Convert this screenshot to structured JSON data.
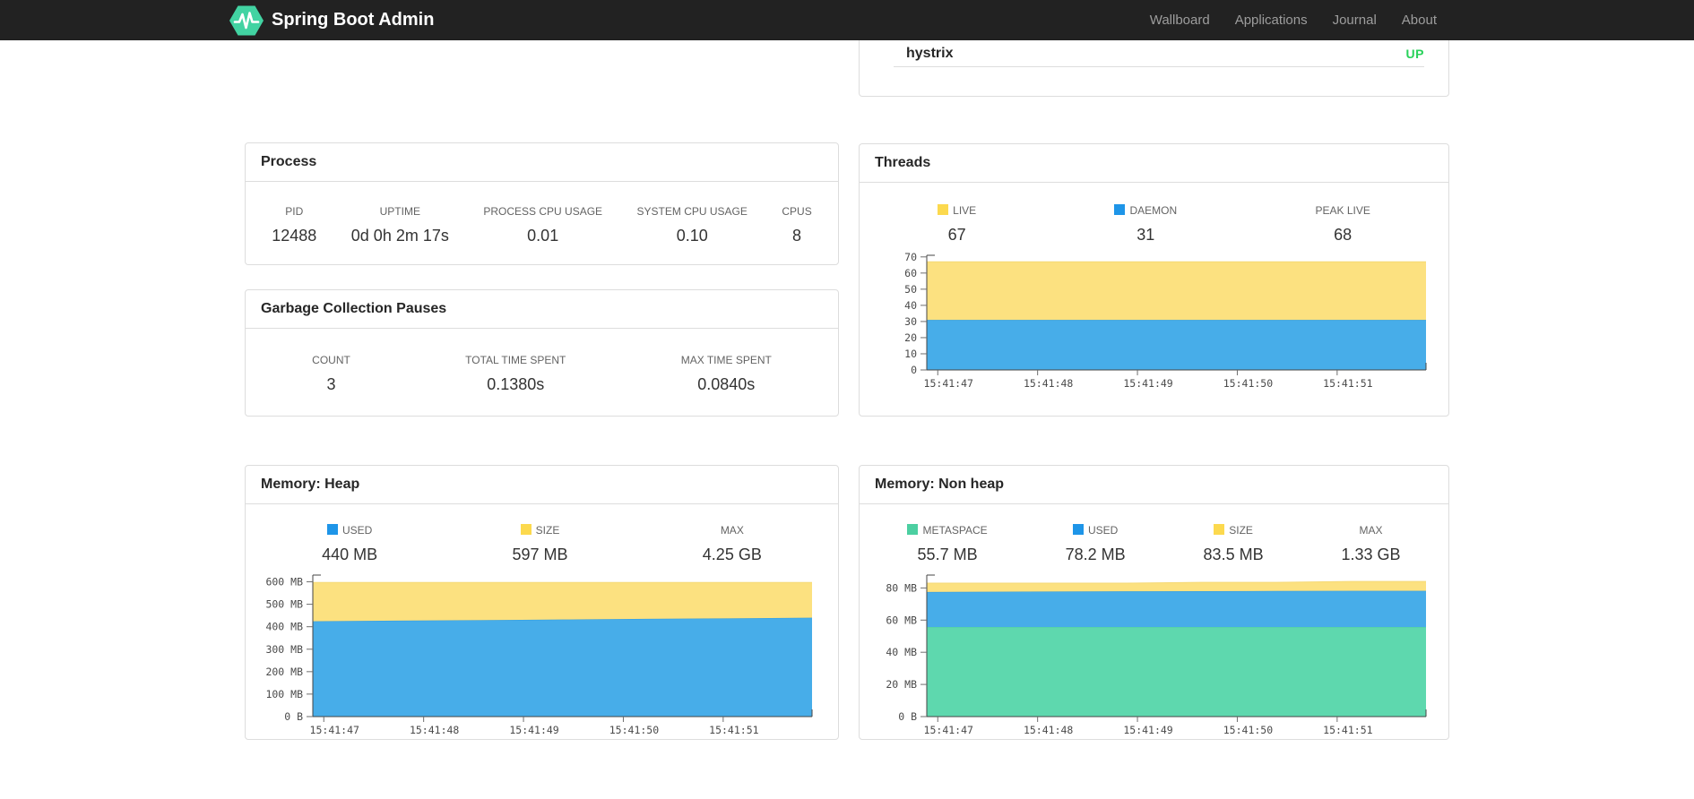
{
  "navbar": {
    "brand": "Spring Boot Admin",
    "items": [
      {
        "label": "Wallboard"
      },
      {
        "label": "Applications"
      },
      {
        "label": "Journal"
      },
      {
        "label": "About"
      }
    ]
  },
  "colors": {
    "navbar_bg": "#222222",
    "nav_link": "#9d9d9d",
    "logo_green": "#42d3a2",
    "status_up": "#28d25a",
    "legend_blue": "#1e95e8",
    "legend_yellow": "#fcd94e",
    "legend_green": "#4ccfa1",
    "area_blue": "#47ade9",
    "area_yellow": "#fce180",
    "area_green": "#5ed8ae",
    "card_border": "#dddddd"
  },
  "health_panel": {
    "row": {
      "name": "hystrix",
      "status": "UP"
    },
    "status_color": "#28d25a"
  },
  "process": {
    "title": "Process",
    "metrics": [
      {
        "label": "PID",
        "value": "12488"
      },
      {
        "label": "UPTIME",
        "value": "0d 0h 2m 17s"
      },
      {
        "label": "PROCESS CPU USAGE",
        "value": "0.01"
      },
      {
        "label": "SYSTEM CPU USAGE",
        "value": "0.10"
      },
      {
        "label": "CPUS",
        "value": "8"
      }
    ]
  },
  "gc": {
    "title": "Garbage Collection Pauses",
    "metrics": [
      {
        "label": "COUNT",
        "value": "3"
      },
      {
        "label": "TOTAL TIME SPENT",
        "value": "0.1380s"
      },
      {
        "label": "MAX TIME SPENT",
        "value": "0.0840s"
      }
    ]
  },
  "threads": {
    "title": "Threads",
    "legend": [
      {
        "label": "LIVE",
        "value": "67",
        "swatch": "#fcd94e"
      },
      {
        "label": "DAEMON",
        "value": "31",
        "swatch": "#1e95e8"
      },
      {
        "label": "PEAK LIVE",
        "value": "68",
        "swatch": ""
      }
    ]
  },
  "memory_heap": {
    "title": "Memory: Heap",
    "legend": [
      {
        "label": "USED",
        "value": "440 MB",
        "swatch": "#1e95e8"
      },
      {
        "label": "SIZE",
        "value": "597 MB",
        "swatch": "#fcd94e"
      },
      {
        "label": "MAX",
        "value": "4.25 GB",
        "swatch": ""
      }
    ]
  },
  "memory_nonheap": {
    "title": "Memory: Non heap",
    "legend": [
      {
        "label": "METASPACE",
        "value": "55.7 MB",
        "swatch": "#4ccfa1"
      },
      {
        "label": "USED",
        "value": "78.2 MB",
        "swatch": "#1e95e8"
      },
      {
        "label": "SIZE",
        "value": "83.5 MB",
        "swatch": "#fcd94e"
      },
      {
        "label": "MAX",
        "value": "1.33 GB",
        "swatch": ""
      }
    ]
  },
  "chart_data": [
    {
      "id": "threads",
      "type": "area",
      "stacked": true,
      "title": "Threads",
      "legend_position": "top",
      "grid": false,
      "x_tick_labels": [
        "15:41:47",
        "15:41:48",
        "15:41:49",
        "15:41:50",
        "15:41:51"
      ],
      "x_tick_fractions": [
        0.022,
        0.222,
        0.422,
        0.622,
        0.822
      ],
      "x_fractions": [
        0,
        0.2,
        0.4,
        0.6,
        0.8,
        1
      ],
      "y_plot_max": 71,
      "y_ticks": [
        {
          "v": 0,
          "label": "0"
        },
        {
          "v": 10,
          "label": "10"
        },
        {
          "v": 20,
          "label": "20"
        },
        {
          "v": 30,
          "label": "30"
        },
        {
          "v": 40,
          "label": "40"
        },
        {
          "v": 50,
          "label": "50"
        },
        {
          "v": 60,
          "label": "60"
        },
        {
          "v": 70,
          "label": "70"
        }
      ],
      "series": [
        {
          "name": "DAEMON",
          "color": "#47ade9",
          "line_color": "#2f9ade",
          "cumulative_values": [
            31,
            31,
            31,
            31,
            31,
            31
          ]
        },
        {
          "name": "LIVE",
          "color": "#fce180",
          "line_color": "#f5d977",
          "cumulative_values": [
            67,
            67,
            67,
            67,
            67,
            67
          ]
        }
      ]
    },
    {
      "id": "memory-heap",
      "type": "area",
      "stacked": true,
      "title": "Memory: Heap",
      "legend_position": "top",
      "grid": false,
      "x_tick_labels": [
        "15:41:47",
        "15:41:48",
        "15:41:49",
        "15:41:50",
        "15:41:51"
      ],
      "x_tick_fractions": [
        0.022,
        0.222,
        0.422,
        0.622,
        0.822
      ],
      "x_fractions": [
        0,
        0.167,
        0.333,
        0.5,
        0.667,
        0.833,
        1
      ],
      "y_plot_max": 630,
      "y_ticks": [
        {
          "v": 0,
          "label": "0 B"
        },
        {
          "v": 100,
          "label": "100 MB"
        },
        {
          "v": 200,
          "label": "200 MB"
        },
        {
          "v": 300,
          "label": "300 MB"
        },
        {
          "v": 400,
          "label": "400 MB"
        },
        {
          "v": 500,
          "label": "500 MB"
        },
        {
          "v": 600,
          "label": "600 MB"
        }
      ],
      "series": [
        {
          "name": "USED",
          "color": "#47ade9",
          "line_color": "#2f9ade",
          "cumulative_values": [
            424,
            427,
            429,
            432,
            435,
            437,
            440
          ]
        },
        {
          "name": "SIZE",
          "color": "#fce180",
          "line_color": "#f5d977",
          "cumulative_values": [
            597,
            597,
            597,
            597,
            597,
            597,
            597
          ]
        }
      ]
    },
    {
      "id": "memory-nonheap",
      "type": "area",
      "stacked": true,
      "title": "Memory: Non heap",
      "legend_position": "top",
      "grid": false,
      "x_tick_labels": [
        "15:41:47",
        "15:41:48",
        "15:41:49",
        "15:41:50",
        "15:41:51"
      ],
      "x_tick_fractions": [
        0.022,
        0.222,
        0.422,
        0.622,
        0.822
      ],
      "x_fractions": [
        0,
        0.2,
        0.4,
        0.55,
        0.7,
        0.85,
        1
      ],
      "y_plot_max": 88,
      "y_ticks": [
        {
          "v": 0,
          "label": "0 B"
        },
        {
          "v": 20,
          "label": "20 MB"
        },
        {
          "v": 40,
          "label": "40 MB"
        },
        {
          "v": 60,
          "label": "60 MB"
        },
        {
          "v": 80,
          "label": "80 MB"
        }
      ],
      "series": [
        {
          "name": "METASPACE",
          "color": "#5ed8ae",
          "line_color": "#4ccfa1",
          "cumulative_values": [
            55.7,
            55.7,
            55.7,
            55.7,
            55.7,
            55.7,
            55.7
          ]
        },
        {
          "name": "USED",
          "color": "#47ade9",
          "line_color": "#2f9ade",
          "cumulative_values": [
            77.5,
            77.7,
            77.9,
            78.0,
            78.1,
            78.2,
            78.2
          ]
        },
        {
          "name": "SIZE",
          "color": "#fce180",
          "line_color": "#f5d977",
          "cumulative_values": [
            83.0,
            83.0,
            83.0,
            83.5,
            83.5,
            84.0,
            84.0
          ]
        }
      ]
    }
  ]
}
